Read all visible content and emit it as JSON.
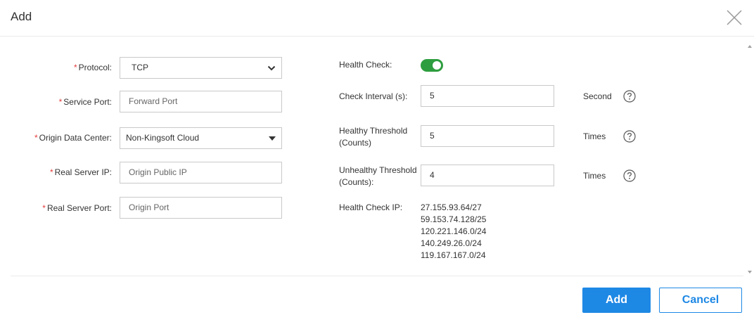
{
  "dialog": {
    "title": "Add"
  },
  "left_form": {
    "protocol": {
      "required": "*",
      "label": "Protocol:",
      "value": "TCP"
    },
    "service_port": {
      "required": "*",
      "label": "Service Port:",
      "placeholder": "Forward Port"
    },
    "origin_dc": {
      "required": "*",
      "label": "Origin Data Center:",
      "value": "Non-Kingsoft Cloud"
    },
    "real_server_ip": {
      "required": "*",
      "label": "Real Server IP:",
      "placeholder": "Origin Public IP"
    },
    "real_server_port": {
      "required": "*",
      "label": "Real Server Port:",
      "placeholder": "Origin Port"
    }
  },
  "right_form": {
    "health_check": {
      "label": "Health Check:",
      "enabled": true
    },
    "check_interval": {
      "label": "Check Interval (s):",
      "value": "5",
      "unit": "Second"
    },
    "healthy_threshold": {
      "label_line1": "Healthy Threshold",
      "label_line2": "(Counts)",
      "value": "5",
      "unit": "Times"
    },
    "unhealthy_threshold": {
      "label_line1": "Unhealthy Threshold",
      "label_line2": "(Counts):",
      "value": "4",
      "unit": "Times"
    },
    "health_check_ip": {
      "label": "Health Check IP:",
      "ips": [
        "27.155.93.64/27",
        "59.153.74.128/25",
        "120.221.146.0/24",
        "140.249.26.0/24",
        "119.167.167.0/24"
      ]
    }
  },
  "footer": {
    "add_label": "Add",
    "cancel_label": "Cancel"
  },
  "colors": {
    "primary": "#1e88e5",
    "toggle_on": "#2e9d3f",
    "required": "#e43c3c"
  },
  "icons": {
    "close": "close-icon",
    "help": "question-circle-icon",
    "dropdown": "chevron-down-icon"
  }
}
